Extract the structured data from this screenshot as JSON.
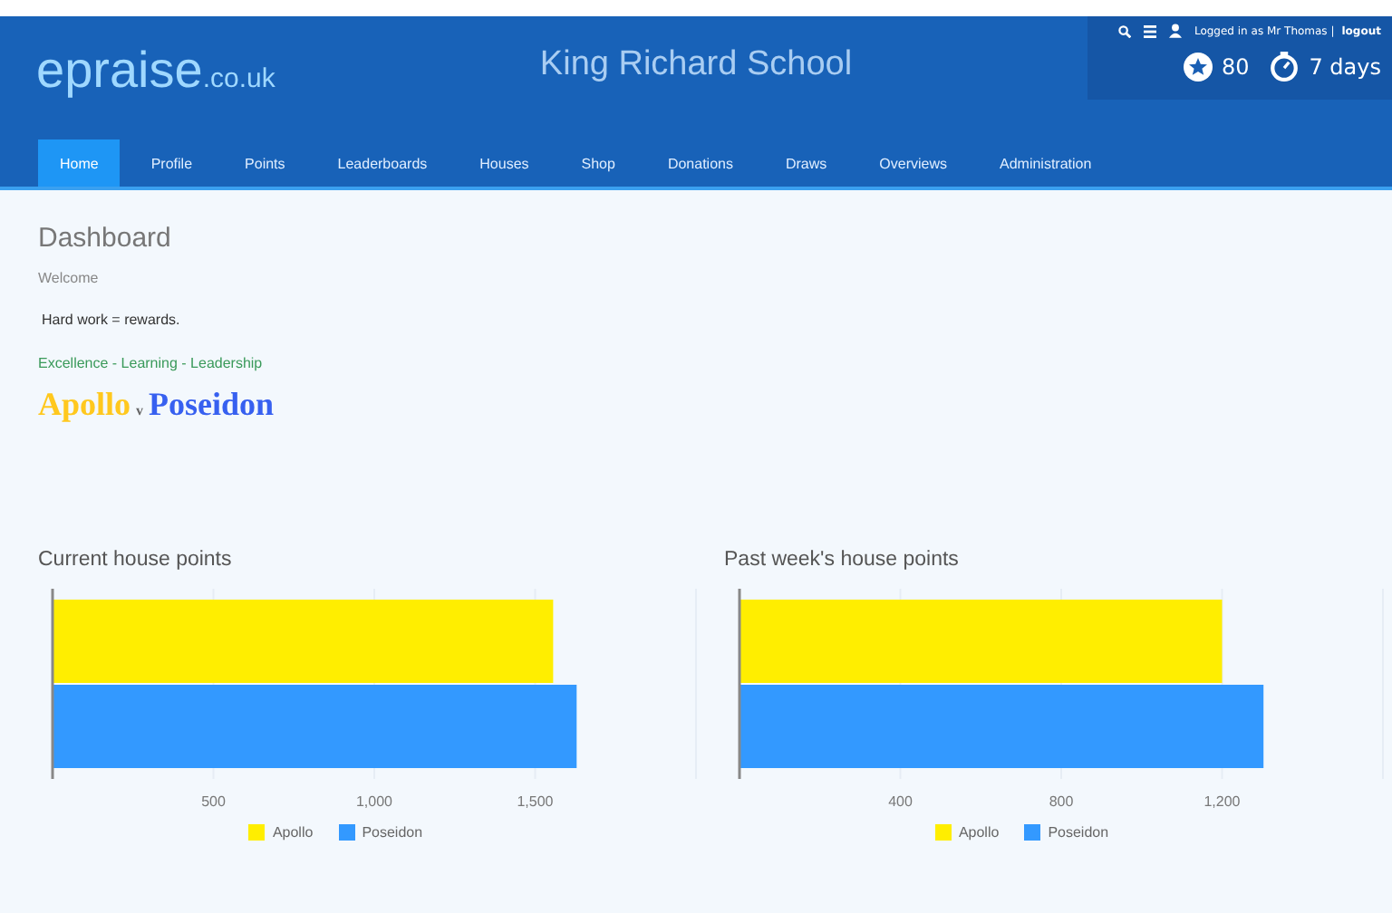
{
  "header": {
    "logo_main": "epraise",
    "logo_suffix": ".co.uk",
    "school": "King Richard School",
    "login_text": "Logged in as Mr Thomas |",
    "logout": "logout",
    "points": "80",
    "streak": "7 days"
  },
  "nav": [
    {
      "label": "Home",
      "selected": true
    },
    {
      "label": "Profile",
      "selected": false
    },
    {
      "label": "Points",
      "selected": false
    },
    {
      "label": "Leaderboards",
      "selected": false
    },
    {
      "label": "Houses",
      "selected": false
    },
    {
      "label": "Shop",
      "selected": false
    },
    {
      "label": "Donations",
      "selected": false
    },
    {
      "label": "Draws",
      "selected": false
    },
    {
      "label": "Overviews",
      "selected": false
    },
    {
      "label": "Administration",
      "selected": false
    }
  ],
  "dashboard": {
    "title": "Dashboard",
    "welcome": "Welcome",
    "message": "Hard work = rewards.",
    "motto": "Excellence - Learning - Leadership",
    "house_a": "Apollo",
    "versus": "v",
    "house_b": "Poseidon"
  },
  "charts": [
    {
      "chart_data": {
        "type": "bar",
        "orientation": "horizontal",
        "grid": true,
        "title": "Current house points",
        "xlim": [
          0,
          2000
        ],
        "xticks": [
          {
            "value": 500,
            "label": "500"
          },
          {
            "value": 1000,
            "label": "1,000"
          },
          {
            "value": 1500,
            "label": "1,500"
          }
        ],
        "series": [
          {
            "name": "Apollo",
            "color": "#ffee00",
            "values": [
              1556
            ]
          },
          {
            "name": "Poseidon",
            "color": "#3399ff",
            "values": [
              1629
            ]
          }
        ]
      }
    },
    {
      "chart_data": {
        "type": "bar",
        "orientation": "horizontal",
        "grid": true,
        "title": "Past week's house points",
        "xlim": [
          0,
          1600
        ],
        "xticks": [
          {
            "value": 400,
            "label": "400"
          },
          {
            "value": 800,
            "label": "800"
          },
          {
            "value": 1200,
            "label": "1,200"
          }
        ],
        "series": [
          {
            "name": "Apollo",
            "color": "#ffee00",
            "values": [
              1200
            ]
          },
          {
            "name": "Poseidon",
            "color": "#3399ff",
            "values": [
              1303
            ]
          }
        ]
      }
    }
  ]
}
